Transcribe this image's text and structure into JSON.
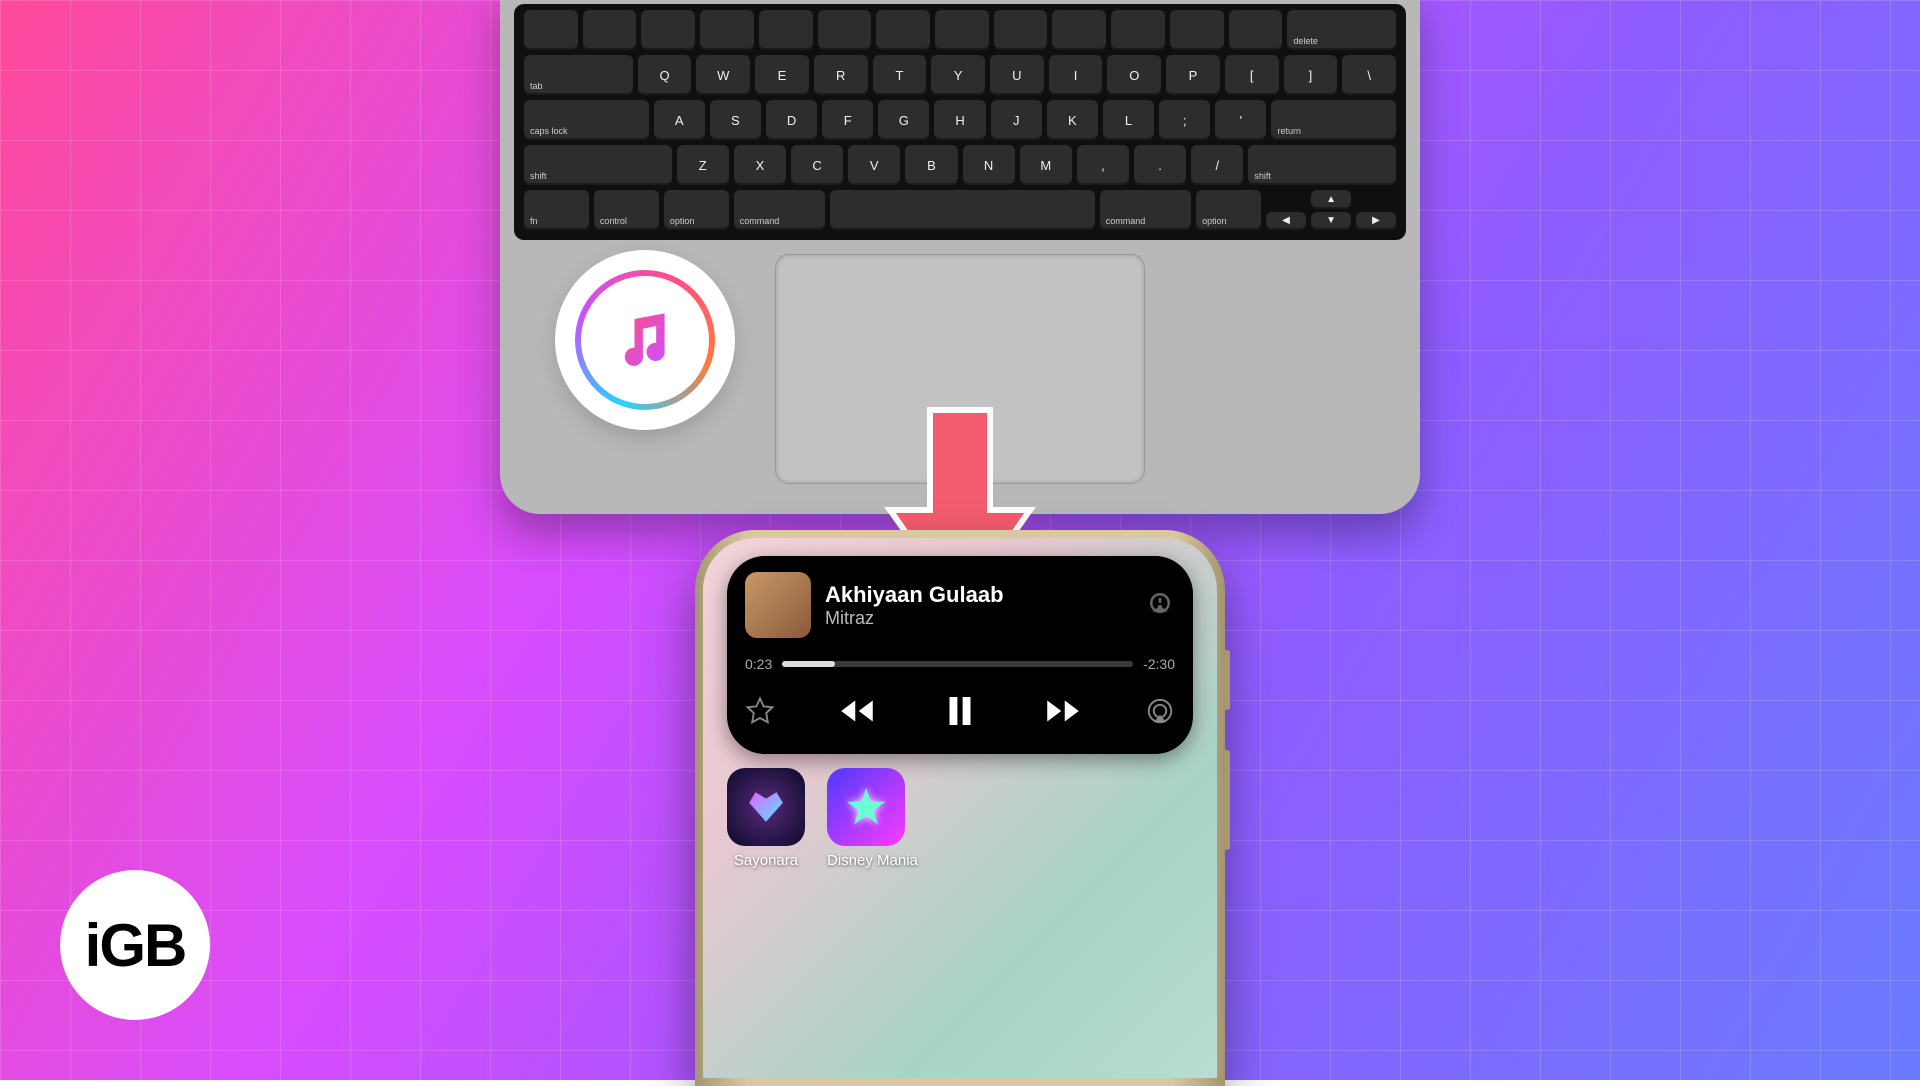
{
  "keyboard": {
    "row1_left": "delete",
    "row2_left": "tab",
    "row2": [
      "Q",
      "W",
      "E",
      "R",
      "T",
      "Y",
      "U",
      "I",
      "O",
      "P",
      "[",
      "]",
      "\\"
    ],
    "row3_left": "caps lock",
    "row3": [
      "A",
      "S",
      "D",
      "F",
      "G",
      "H",
      "J",
      "K",
      "L",
      ";",
      "'"
    ],
    "row3_right": "return",
    "row4_left": "shift",
    "row4": [
      "Z",
      "X",
      "C",
      "V",
      "B",
      "N",
      "M",
      ",",
      ".",
      "/"
    ],
    "row4_right": "shift",
    "row5": {
      "fn": "fn",
      "control": "control",
      "option_l": "option",
      "command_l": "command",
      "space": "",
      "command_r": "command",
      "option_r": "option"
    }
  },
  "now_playing": {
    "title": "Akhiyaan Gulaab",
    "artist": "Mitraz",
    "elapsed": "0:23",
    "remaining": "-2:30"
  },
  "apps": [
    {
      "label": "Sayonara"
    },
    {
      "label": "Disney Mania"
    }
  ],
  "logo_text": "iGB"
}
